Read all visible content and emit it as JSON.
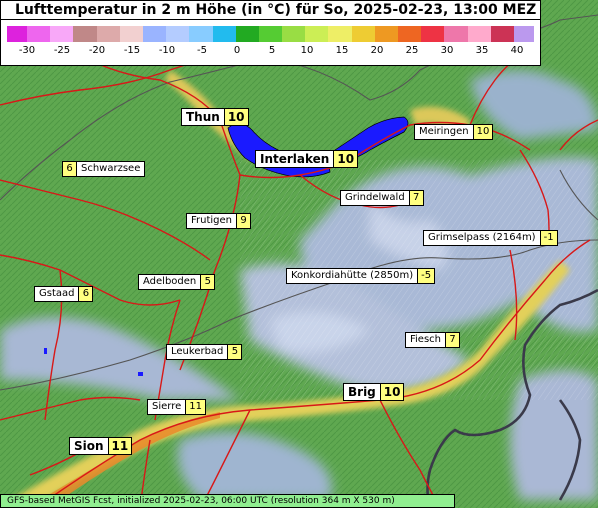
{
  "title": "Lufttemperatur in 2 m Höhe (in °C) für So, 2025-02-23, 13:00 MEZ",
  "legend": {
    "ticks": [
      "-30",
      "-25",
      "-20",
      "-15",
      "-10",
      "-5",
      "0",
      "5",
      "10",
      "15",
      "20",
      "25",
      "30",
      "35",
      "40"
    ],
    "colors": [
      "#dd22dd",
      "#ee66ee",
      "#f8a8f8",
      "#c08888",
      "#ddaaaa",
      "#f2d0d0",
      "#9ab4ff",
      "#b4ccff",
      "#88ccff",
      "#22bbee",
      "#22aa22",
      "#55cc33",
      "#99dd44",
      "#ccee55",
      "#eeee66",
      "#eecc33",
      "#ee9922",
      "#ee6622",
      "#ee3344",
      "#ee77aa",
      "#ffaacc",
      "#cc3355",
      "#bb99ee"
    ]
  },
  "locations": [
    {
      "name": "Thun",
      "value": "10"
    },
    {
      "name": "Interlaken",
      "value": "10"
    },
    {
      "name": "Meiringen",
      "value": "10"
    },
    {
      "name": "Schwarzsee",
      "value": "6"
    },
    {
      "name": "Grindelwald",
      "value": "7"
    },
    {
      "name": "Frutigen",
      "value": "9"
    },
    {
      "name": "Grimselpass (2164m)",
      "value": "-1"
    },
    {
      "name": "Konkordiahütte (2850m)",
      "value": "-5"
    },
    {
      "name": "Adelboden",
      "value": "5"
    },
    {
      "name": "Gstaad",
      "value": "6"
    },
    {
      "name": "Fiesch",
      "value": "7"
    },
    {
      "name": "Leukerbad",
      "value": "5"
    },
    {
      "name": "Brig",
      "value": "10"
    },
    {
      "name": "Sierre",
      "value": "11"
    },
    {
      "name": "Sion",
      "value": "11"
    }
  ],
  "footer": "GFS-based MetGIS Fcst, initialized 2025-02-23, 06:00 UTC  (resolution 364 m X 530 m)"
}
